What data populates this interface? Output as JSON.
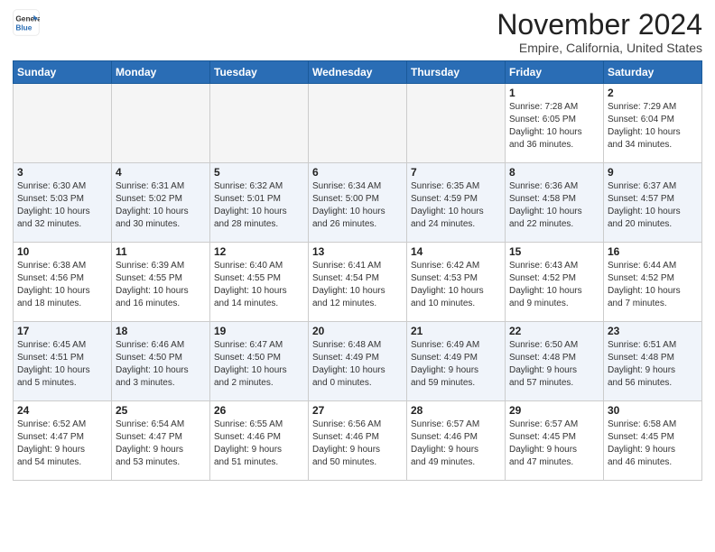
{
  "header": {
    "logo_general": "General",
    "logo_blue": "Blue",
    "month_title": "November 2024",
    "location": "Empire, California, United States"
  },
  "days_of_week": [
    "Sunday",
    "Monday",
    "Tuesday",
    "Wednesday",
    "Thursday",
    "Friday",
    "Saturday"
  ],
  "weeks": [
    [
      {
        "day": "",
        "info": "",
        "empty": true
      },
      {
        "day": "",
        "info": "",
        "empty": true
      },
      {
        "day": "",
        "info": "",
        "empty": true
      },
      {
        "day": "",
        "info": "",
        "empty": true
      },
      {
        "day": "",
        "info": "",
        "empty": true
      },
      {
        "day": "1",
        "info": "Sunrise: 7:28 AM\nSunset: 6:05 PM\nDaylight: 10 hours\nand 36 minutes."
      },
      {
        "day": "2",
        "info": "Sunrise: 7:29 AM\nSunset: 6:04 PM\nDaylight: 10 hours\nand 34 minutes."
      }
    ],
    [
      {
        "day": "3",
        "info": "Sunrise: 6:30 AM\nSunset: 5:03 PM\nDaylight: 10 hours\nand 32 minutes."
      },
      {
        "day": "4",
        "info": "Sunrise: 6:31 AM\nSunset: 5:02 PM\nDaylight: 10 hours\nand 30 minutes."
      },
      {
        "day": "5",
        "info": "Sunrise: 6:32 AM\nSunset: 5:01 PM\nDaylight: 10 hours\nand 28 minutes."
      },
      {
        "day": "6",
        "info": "Sunrise: 6:34 AM\nSunset: 5:00 PM\nDaylight: 10 hours\nand 26 minutes."
      },
      {
        "day": "7",
        "info": "Sunrise: 6:35 AM\nSunset: 4:59 PM\nDaylight: 10 hours\nand 24 minutes."
      },
      {
        "day": "8",
        "info": "Sunrise: 6:36 AM\nSunset: 4:58 PM\nDaylight: 10 hours\nand 22 minutes."
      },
      {
        "day": "9",
        "info": "Sunrise: 6:37 AM\nSunset: 4:57 PM\nDaylight: 10 hours\nand 20 minutes."
      }
    ],
    [
      {
        "day": "10",
        "info": "Sunrise: 6:38 AM\nSunset: 4:56 PM\nDaylight: 10 hours\nand 18 minutes."
      },
      {
        "day": "11",
        "info": "Sunrise: 6:39 AM\nSunset: 4:55 PM\nDaylight: 10 hours\nand 16 minutes."
      },
      {
        "day": "12",
        "info": "Sunrise: 6:40 AM\nSunset: 4:55 PM\nDaylight: 10 hours\nand 14 minutes."
      },
      {
        "day": "13",
        "info": "Sunrise: 6:41 AM\nSunset: 4:54 PM\nDaylight: 10 hours\nand 12 minutes."
      },
      {
        "day": "14",
        "info": "Sunrise: 6:42 AM\nSunset: 4:53 PM\nDaylight: 10 hours\nand 10 minutes."
      },
      {
        "day": "15",
        "info": "Sunrise: 6:43 AM\nSunset: 4:52 PM\nDaylight: 10 hours\nand 9 minutes."
      },
      {
        "day": "16",
        "info": "Sunrise: 6:44 AM\nSunset: 4:52 PM\nDaylight: 10 hours\nand 7 minutes."
      }
    ],
    [
      {
        "day": "17",
        "info": "Sunrise: 6:45 AM\nSunset: 4:51 PM\nDaylight: 10 hours\nand 5 minutes."
      },
      {
        "day": "18",
        "info": "Sunrise: 6:46 AM\nSunset: 4:50 PM\nDaylight: 10 hours\nand 3 minutes."
      },
      {
        "day": "19",
        "info": "Sunrise: 6:47 AM\nSunset: 4:50 PM\nDaylight: 10 hours\nand 2 minutes."
      },
      {
        "day": "20",
        "info": "Sunrise: 6:48 AM\nSunset: 4:49 PM\nDaylight: 10 hours\nand 0 minutes."
      },
      {
        "day": "21",
        "info": "Sunrise: 6:49 AM\nSunset: 4:49 PM\nDaylight: 9 hours\nand 59 minutes."
      },
      {
        "day": "22",
        "info": "Sunrise: 6:50 AM\nSunset: 4:48 PM\nDaylight: 9 hours\nand 57 minutes."
      },
      {
        "day": "23",
        "info": "Sunrise: 6:51 AM\nSunset: 4:48 PM\nDaylight: 9 hours\nand 56 minutes."
      }
    ],
    [
      {
        "day": "24",
        "info": "Sunrise: 6:52 AM\nSunset: 4:47 PM\nDaylight: 9 hours\nand 54 minutes."
      },
      {
        "day": "25",
        "info": "Sunrise: 6:54 AM\nSunset: 4:47 PM\nDaylight: 9 hours\nand 53 minutes."
      },
      {
        "day": "26",
        "info": "Sunrise: 6:55 AM\nSunset: 4:46 PM\nDaylight: 9 hours\nand 51 minutes."
      },
      {
        "day": "27",
        "info": "Sunrise: 6:56 AM\nSunset: 4:46 PM\nDaylight: 9 hours\nand 50 minutes."
      },
      {
        "day": "28",
        "info": "Sunrise: 6:57 AM\nSunset: 4:46 PM\nDaylight: 9 hours\nand 49 minutes."
      },
      {
        "day": "29",
        "info": "Sunrise: 6:57 AM\nSunset: 4:45 PM\nDaylight: 9 hours\nand 47 minutes."
      },
      {
        "day": "30",
        "info": "Sunrise: 6:58 AM\nSunset: 4:45 PM\nDaylight: 9 hours\nand 46 minutes."
      }
    ]
  ]
}
